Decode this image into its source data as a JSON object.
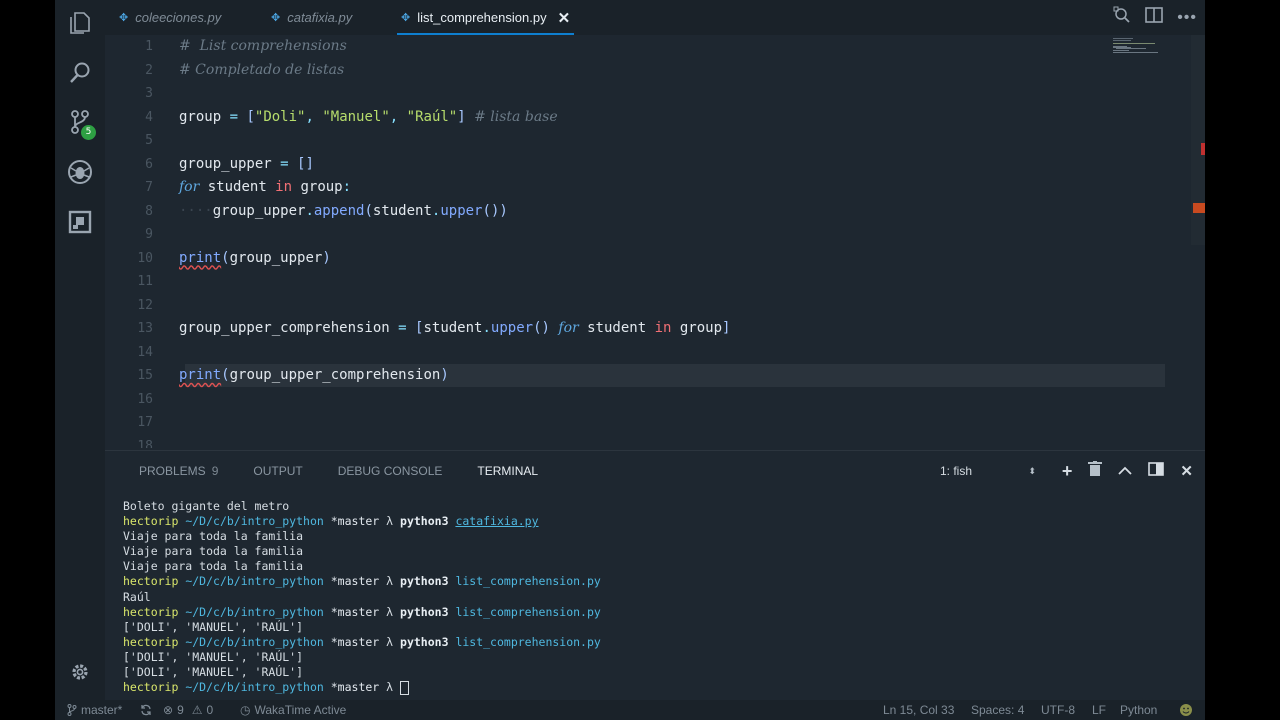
{
  "tabs": [
    {
      "name": "coleeciones.py",
      "active": false
    },
    {
      "name": "catafixia.py",
      "active": false
    },
    {
      "name": "list_comprehension.py",
      "active": true
    }
  ],
  "activity": {
    "scm_badge": "5"
  },
  "editor": {
    "current_line": 15,
    "lines": [
      {
        "n": "1",
        "text": "#  List comprehensions"
      },
      {
        "n": "2",
        "text": "# Completado de listas"
      },
      {
        "n": "3",
        "text": ""
      },
      {
        "n": "4",
        "text": "group = [\"Doli\", \"Manuel\", \"Raúl\"] # lista base"
      },
      {
        "n": "5",
        "text": ""
      },
      {
        "n": "6",
        "text": "group_upper = []"
      },
      {
        "n": "7",
        "text": "for student in group:"
      },
      {
        "n": "8",
        "text": "    group_upper.append(student.upper())"
      },
      {
        "n": "9",
        "text": ""
      },
      {
        "n": "10",
        "text": "print(group_upper)"
      },
      {
        "n": "11",
        "text": ""
      },
      {
        "n": "12",
        "text": ""
      },
      {
        "n": "13",
        "text": "group_upper_comprehension = [student.upper() for student in group]"
      },
      {
        "n": "14",
        "text": ""
      },
      {
        "n": "15",
        "text": "print(group_upper_comprehension)"
      },
      {
        "n": "16",
        "text": ""
      },
      {
        "n": "17",
        "text": ""
      },
      {
        "n": "18",
        "text": ""
      }
    ]
  },
  "panel": {
    "tabs": [
      {
        "label": "PROBLEMS",
        "count": "9"
      },
      {
        "label": "OUTPUT"
      },
      {
        "label": "DEBUG CONSOLE"
      },
      {
        "label": "TERMINAL",
        "active": true
      }
    ],
    "terminal_select": "1: fish"
  },
  "terminal": {
    "prompt_user": "hectorip",
    "prompt_path": "~/D/c/b/intro_python",
    "prompt_branch": "*master",
    "prompt_lambda": "λ",
    "lines": [
      {
        "kind": "out",
        "text": "Boleto gigante del metro"
      },
      {
        "kind": "cmd",
        "cmd": "python3",
        "file": "catafixia.py",
        "underline": true
      },
      {
        "kind": "out",
        "text": "Viaje para toda la familia"
      },
      {
        "kind": "out",
        "text": "Viaje para toda la familia"
      },
      {
        "kind": "out",
        "text": "Viaje para toda la familia"
      },
      {
        "kind": "cmd",
        "cmd": "python3",
        "file": "list_comprehension.py"
      },
      {
        "kind": "out",
        "text": "Raúl"
      },
      {
        "kind": "cmd",
        "cmd": "python3",
        "file": "list_comprehension.py"
      },
      {
        "kind": "out",
        "text": "['DOLI', 'MANUEL', 'RAÚL']"
      },
      {
        "kind": "cmd",
        "cmd": "python3",
        "file": "list_comprehension.py"
      },
      {
        "kind": "out",
        "text": "['DOLI', 'MANUEL', 'RAÚL']"
      },
      {
        "kind": "out",
        "text": "['DOLI', 'MANUEL', 'RAÚL']"
      },
      {
        "kind": "prompt"
      }
    ]
  },
  "status": {
    "branch": "master*",
    "errors": "9",
    "warnings": "0",
    "wakatime": "WakaTime Active",
    "position": "Ln 15, Col 33",
    "spaces": "Spaces: 4",
    "encoding": "UTF-8",
    "eol": "LF",
    "language": "Python"
  },
  "colors": {
    "accent": "#0e7fd0",
    "background": "#1e2730",
    "string": "#b7dd6c",
    "keyword": "#5fa8e0"
  }
}
